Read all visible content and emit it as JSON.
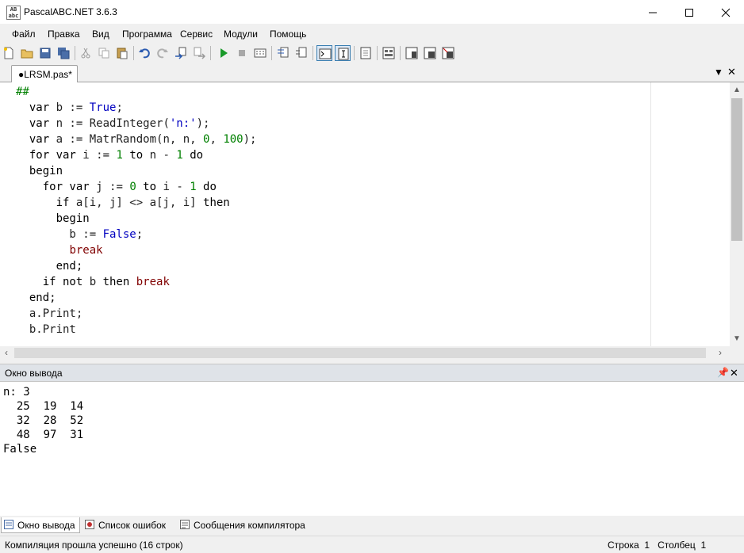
{
  "window": {
    "title": "PascalABC.NET 3.6.3",
    "icon_text_top": "AB",
    "icon_text_bottom": "abc"
  },
  "menu": [
    "Файл",
    "Правка",
    "Вид",
    "Программа",
    "Сервис",
    "Модули",
    "Помощь"
  ],
  "toolbar_icons": [
    "new-file-icon",
    "open-icon",
    "save-icon",
    "save-all-icon",
    "cut-icon",
    "copy-icon",
    "paste-icon",
    "undo-icon",
    "redo-icon",
    "step-in-icon",
    "step-out-icon",
    "run-icon",
    "stop-icon",
    "compile-icon",
    "comment-icon",
    "uncomment-icon",
    "console-icon",
    "text-icon",
    "window-icon",
    "form-icon",
    "debug1-icon",
    "debug2-icon",
    "debug3-icon"
  ],
  "editor": {
    "tab_label": "●LRSM.pas*",
    "code": [
      [
        {
          "t": "##",
          "c": "cmt"
        }
      ],
      [
        {
          "t": "  var ",
          "c": "kw"
        },
        {
          "t": "b := ",
          "c": "id"
        },
        {
          "t": "True",
          "c": "const"
        },
        {
          "t": ";",
          "c": "id"
        }
      ],
      [
        {
          "t": "  var ",
          "c": "kw"
        },
        {
          "t": "n := ReadInteger(",
          "c": "id"
        },
        {
          "t": "'n:'",
          "c": "str"
        },
        {
          "t": ");",
          "c": "id"
        }
      ],
      [
        {
          "t": "  var ",
          "c": "kw"
        },
        {
          "t": "a := MatrRandom(n, n, ",
          "c": "id"
        },
        {
          "t": "0",
          "c": "num"
        },
        {
          "t": ", ",
          "c": "id"
        },
        {
          "t": "100",
          "c": "num"
        },
        {
          "t": ");",
          "c": "id"
        }
      ],
      [
        {
          "t": "  for var ",
          "c": "kw"
        },
        {
          "t": "i := ",
          "c": "id"
        },
        {
          "t": "1",
          "c": "num"
        },
        {
          "t": " to ",
          "c": "kw"
        },
        {
          "t": "n - ",
          "c": "id"
        },
        {
          "t": "1",
          "c": "num"
        },
        {
          "t": " do",
          "c": "kw"
        }
      ],
      [
        {
          "t": "  begin",
          "c": "kw"
        }
      ],
      [
        {
          "t": "    for var ",
          "c": "kw"
        },
        {
          "t": "j := ",
          "c": "id"
        },
        {
          "t": "0",
          "c": "num"
        },
        {
          "t": " to ",
          "c": "kw"
        },
        {
          "t": "i - ",
          "c": "id"
        },
        {
          "t": "1",
          "c": "num"
        },
        {
          "t": " do",
          "c": "kw"
        }
      ],
      [
        {
          "t": "      if ",
          "c": "kw"
        },
        {
          "t": "a[i, j] <> a[j, i] ",
          "c": "id"
        },
        {
          "t": "then",
          "c": "kw"
        }
      ],
      [
        {
          "t": "      begin",
          "c": "kw"
        }
      ],
      [
        {
          "t": "        b := ",
          "c": "id"
        },
        {
          "t": "False",
          "c": "const"
        },
        {
          "t": ";",
          "c": "id"
        }
      ],
      [
        {
          "t": "        ",
          "c": "id"
        },
        {
          "t": "break",
          "c": "brk"
        }
      ],
      [
        {
          "t": "      end;",
          "c": "kw"
        }
      ],
      [
        {
          "t": "    if not ",
          "c": "kw"
        },
        {
          "t": "b ",
          "c": "id"
        },
        {
          "t": "then ",
          "c": "kw"
        },
        {
          "t": "break",
          "c": "brk"
        }
      ],
      [
        {
          "t": "  end;",
          "c": "kw"
        }
      ],
      [
        {
          "t": "  a.Print;",
          "c": "id"
        }
      ],
      [
        {
          "t": "  b.Print",
          "c": "id"
        }
      ]
    ]
  },
  "output": {
    "title": "Окно вывода",
    "text": "n: 3\n  25  19  14\n  32  28  52\n  48  97  31\nFalse"
  },
  "bottom_tabs": [
    "Окно вывода",
    "Список ошибок",
    "Сообщения компилятора"
  ],
  "status": {
    "message": "Компиляция прошла успешно (16 строк)",
    "row_label": "Строка",
    "row_value": "1",
    "col_label": "Столбец",
    "col_value": "1"
  }
}
